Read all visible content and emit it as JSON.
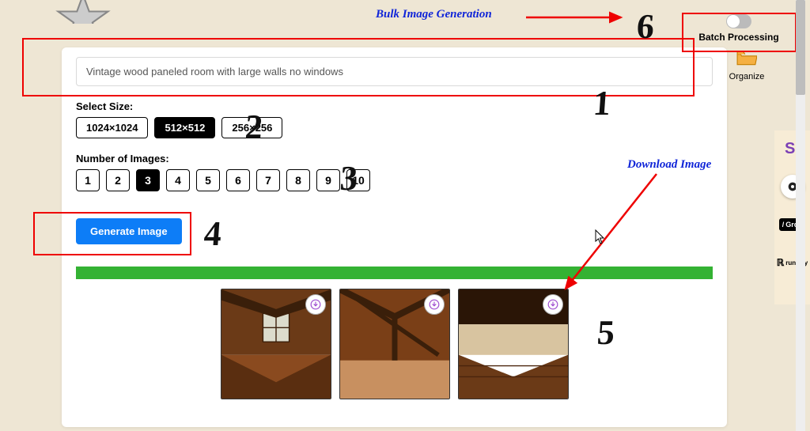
{
  "annotations": {
    "bulk_generation": "Bulk Image Generation",
    "download_image": "Download Image",
    "step1": "1",
    "step2": "2",
    "step3": "3",
    "step4": "4",
    "step5": "5",
    "step6": "6"
  },
  "batch": {
    "label": "Batch Processing",
    "enabled": false
  },
  "organize": {
    "label": "Organize"
  },
  "prompt": {
    "value": "Vintage wood paneled room with large walls no windows"
  },
  "size": {
    "label": "Select Size:",
    "options": [
      "1024×1024",
      "512×512",
      "256×256"
    ],
    "selected": "512×512"
  },
  "count": {
    "label": "Number of Images:",
    "options": [
      "1",
      "2",
      "3",
      "4",
      "5",
      "6",
      "7",
      "8",
      "9",
      "10"
    ],
    "selected": "3"
  },
  "generate": {
    "label": "Generate Image"
  },
  "results": {
    "images": [
      {
        "name": "result-1",
        "description": "wood paneled room with window"
      },
      {
        "name": "result-2",
        "description": "wood paneled attic room"
      },
      {
        "name": "result-3",
        "description": "large empty wood floor room"
      }
    ]
  },
  "sidebar": {
    "items": [
      {
        "id": "s-logo",
        "label": "S."
      },
      {
        "id": "camera",
        "label": "camera"
      },
      {
        "id": "grok",
        "label": "Grok"
      },
      {
        "id": "runway",
        "label": "runway"
      }
    ]
  },
  "colors": {
    "accent_blue": "#0d7df7",
    "progress_green": "#34b233",
    "annotation_red": "#e00000",
    "annotation_text": "#1025d8"
  }
}
